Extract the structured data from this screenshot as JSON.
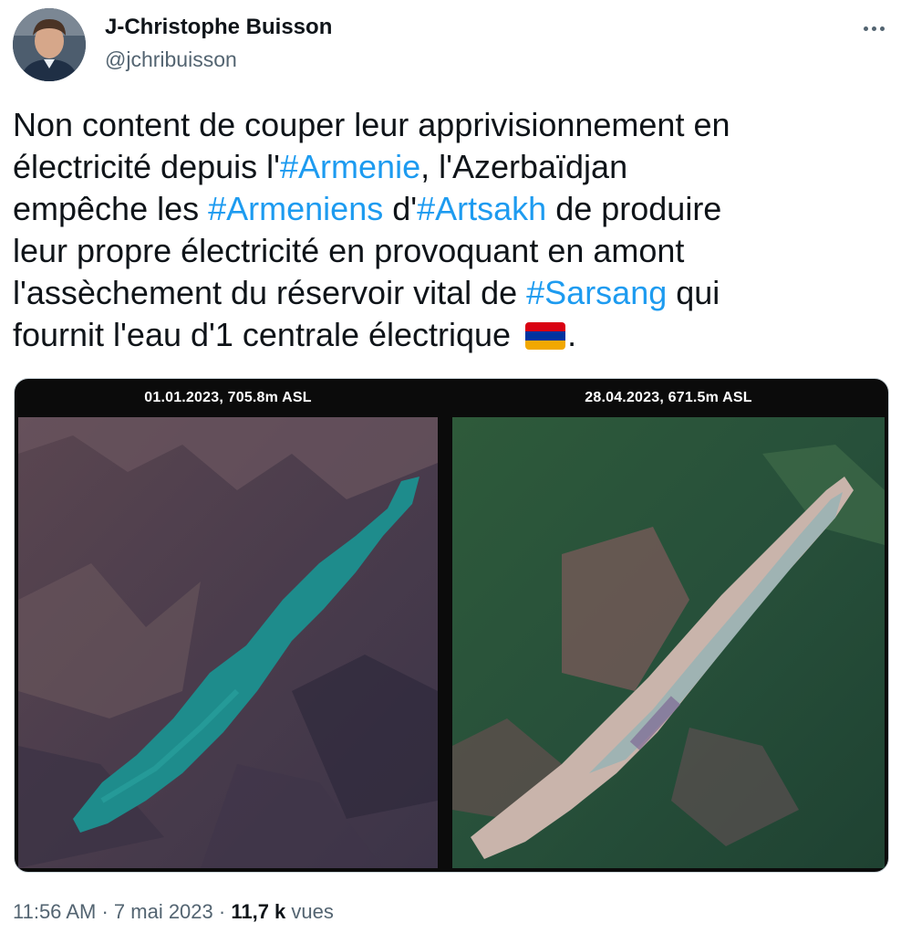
{
  "author": {
    "name": "J-Christophe Buisson",
    "handle": "@jchribuisson"
  },
  "tweet": {
    "lines": [
      [
        {
          "t": "Non content de couper leur apprivisionnement en"
        }
      ],
      [
        {
          "t": "électricité depuis l'"
        },
        {
          "t": "#Armenie",
          "tag": true
        },
        {
          "t": ", l'Azerbaïdjan"
        }
      ],
      [
        {
          "t": "empêche les "
        },
        {
          "t": "#Armeniens",
          "tag": true
        },
        {
          "t": " d'"
        },
        {
          "t": "#Artsakh",
          "tag": true
        },
        {
          "t": " de produire"
        }
      ],
      [
        {
          "t": "leur propre électricité en provoquant en amont"
        }
      ],
      [
        {
          "t": "l'assèchement du réservoir vital de "
        },
        {
          "t": "#Sarsang",
          "tag": true
        },
        {
          "t": " qui"
        }
      ],
      [
        {
          "t": "fournit l'eau d'1 centrale électrique "
        },
        {
          "flag": true
        },
        {
          "t": "."
        }
      ]
    ],
    "flag_colors": [
      "#d90012",
      "#0033a0",
      "#f2a800"
    ]
  },
  "media": {
    "left_caption": "01.01.2023, 705.8m ASL",
    "right_caption": "28.04.2023, 671.5m ASL",
    "left_image": "satellite-reservoir-full",
    "right_image": "satellite-reservoir-drained"
  },
  "meta": {
    "time": "11:56 AM",
    "separator": "·",
    "date": "7 mai 2023",
    "views_count": "11,7 k",
    "views_label": "vues"
  },
  "colors": {
    "link": "#1d9bf0",
    "text": "#0f1419",
    "secondary": "#536471"
  }
}
